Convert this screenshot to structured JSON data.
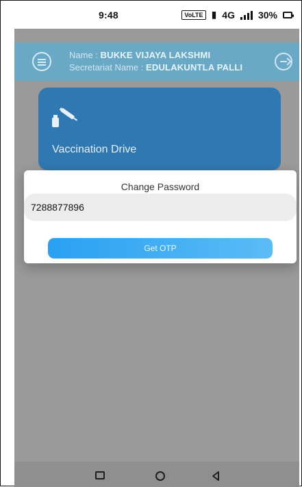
{
  "status_bar": {
    "time": "9:48",
    "volte_label": "VoLTE",
    "network_label": "4G",
    "battery": "30%"
  },
  "header": {
    "name_label": "Name :",
    "name_value": "BUKKE VIJAYA LAKSHMI",
    "secretariat_label": "Secretariat Name :",
    "secretariat_value": "EDULAKUNTLA PALLI"
  },
  "card": {
    "title": "Vaccination Drive"
  },
  "dialog": {
    "title": "Change Password",
    "phone_value": "7288877896",
    "button_label": "Get OTP"
  },
  "colors": {
    "header": "#6aa9c6",
    "card": "#2f78b1",
    "button_start": "#2aa0f2",
    "button_end": "#5bbcf6",
    "overlay": "#9a9a9a"
  },
  "icons": [
    "menu-icon",
    "logout-icon",
    "vaccination-icon",
    "recent-apps-icon",
    "home-icon",
    "back-icon"
  ]
}
